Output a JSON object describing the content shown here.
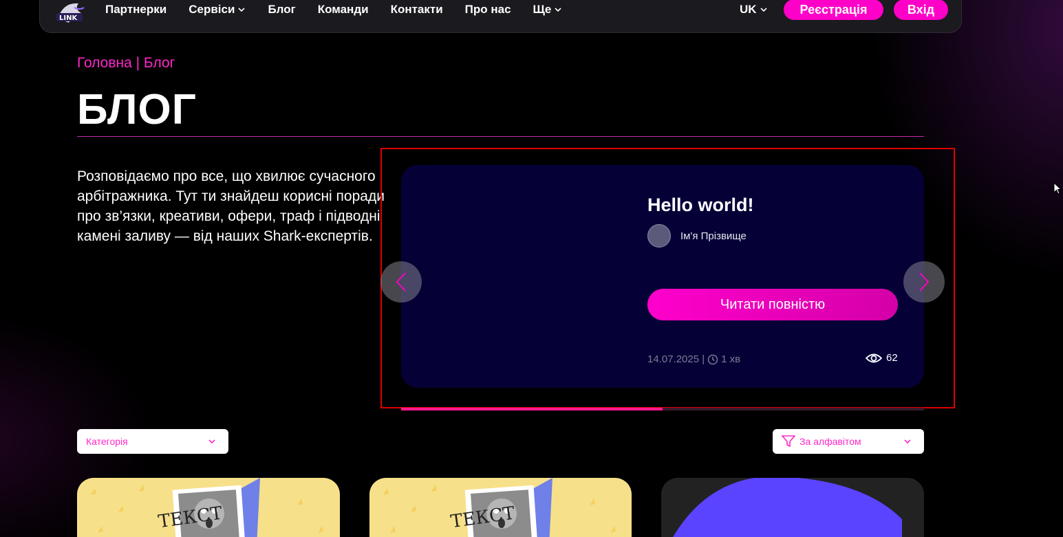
{
  "nav": {
    "logo_text": "LINK",
    "items": [
      {
        "label": "Партнерки",
        "dropdown": false
      },
      {
        "label": "Сервіси",
        "dropdown": true
      },
      {
        "label": "Блог",
        "dropdown": false
      },
      {
        "label": "Команди",
        "dropdown": false
      },
      {
        "label": "Контакти",
        "dropdown": false
      },
      {
        "label": "Про нас",
        "dropdown": false
      },
      {
        "label": "Ще",
        "dropdown": true
      }
    ],
    "lang": "UK",
    "register_label": "Реєстрація",
    "login_label": "Вхід"
  },
  "hero": {
    "breadcrumb": "Головна | Блог",
    "title": "БЛОГ",
    "intro": "Розповідаємо про все, що хвилює сучасного арбітражника.  Тут ти знайдеш корисні поради про зв’язки, креативи, офери, траф і підводні камені заливу — від наших Shark-експертів."
  },
  "slider": {
    "post_title": "Hello world!",
    "author": "Ім'я Прізвище",
    "read_label": "Читати повністю",
    "date": "14.07.2025 |",
    "read_time": "1 хв",
    "views": "62",
    "progress": 0.5
  },
  "filters": {
    "category_label": "Категорія",
    "sort_label": "За алфавітом"
  },
  "cards": [
    {
      "image_text": "ТЕКСТ"
    },
    {
      "image_text": "ТЕКСТ"
    },
    {
      "image_text": ""
    }
  ],
  "colors": {
    "accent": "#ff00c8",
    "slide_bg": "#050137",
    "card_yellow": "#f7e08a",
    "card_blue": "#5a44ff"
  }
}
